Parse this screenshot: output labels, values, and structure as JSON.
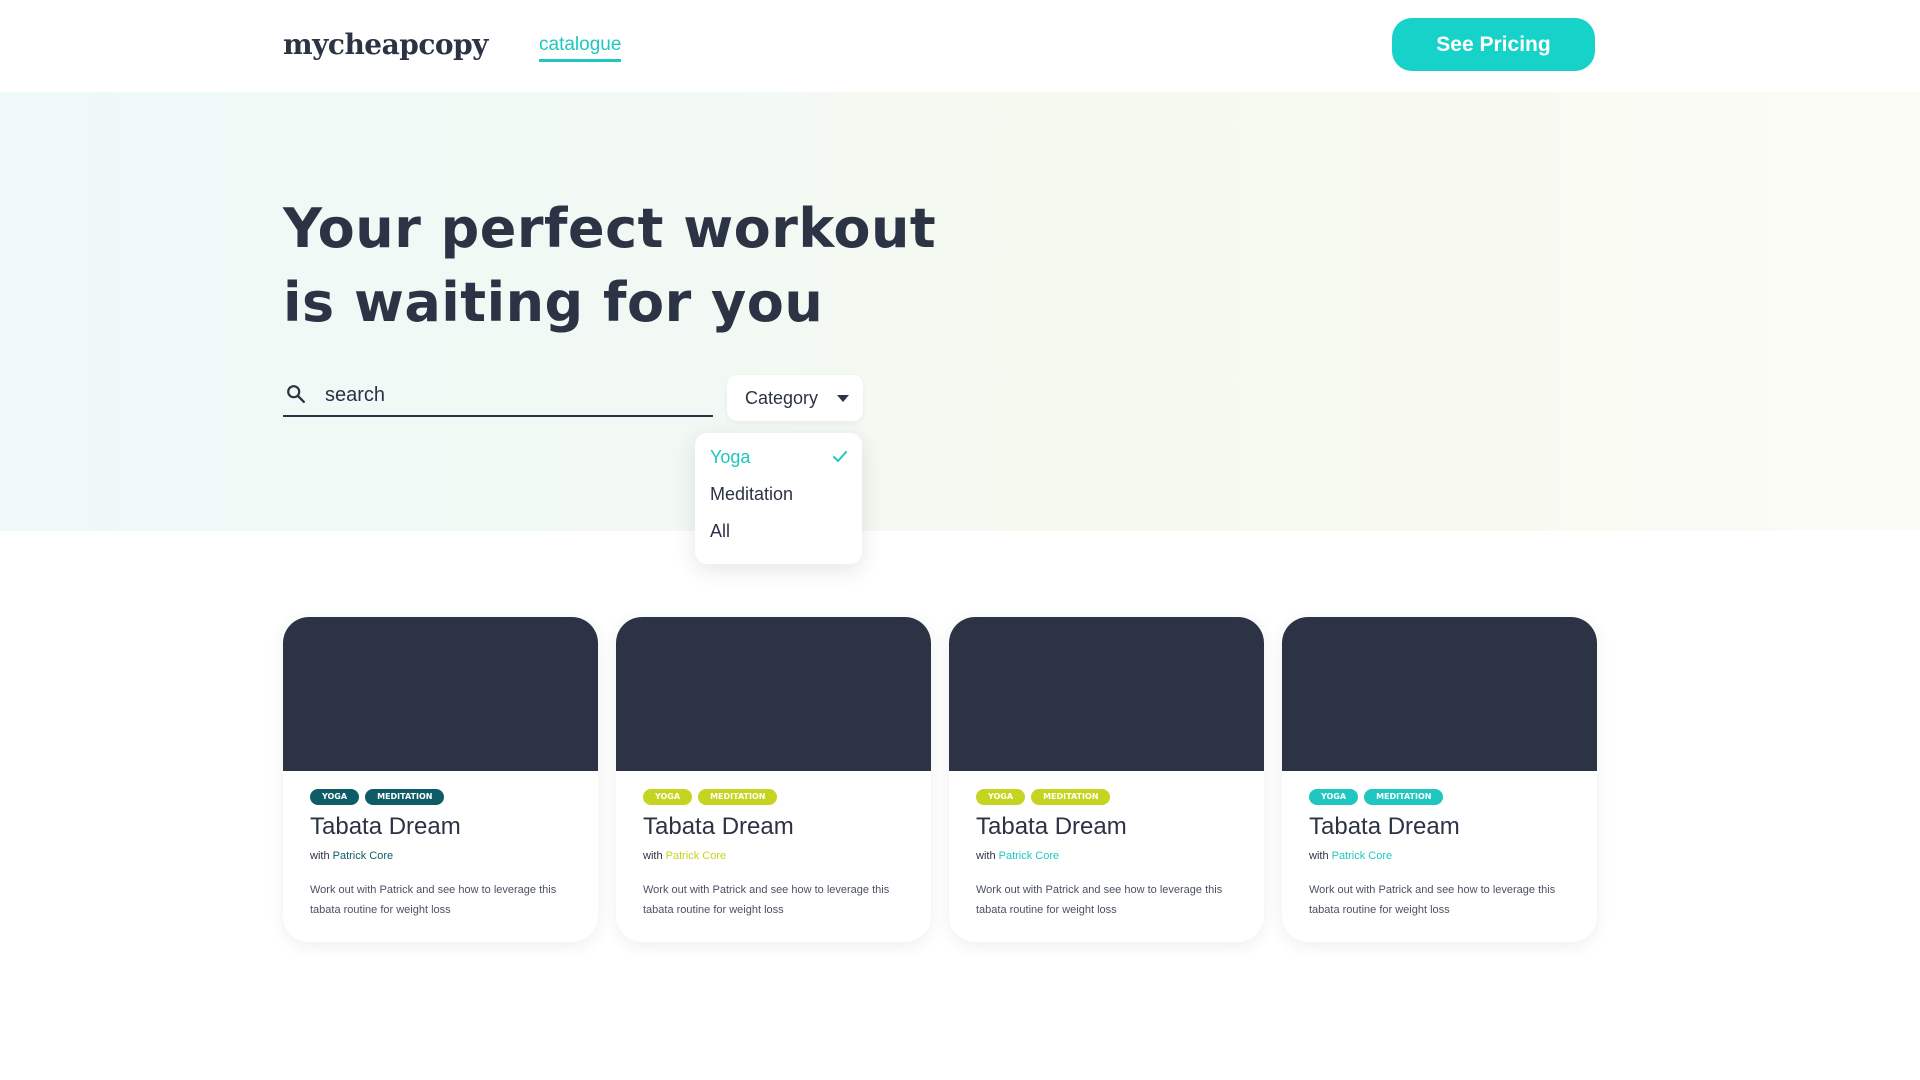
{
  "header": {
    "logo": "mycheapcopy",
    "nav_link": "catalogue",
    "pricing_button": "See Pricing"
  },
  "hero": {
    "title_line1": "Your perfect workout",
    "title_line2": "is waiting for you",
    "search_placeholder": "search",
    "category_label": "Category"
  },
  "dropdown": {
    "options": [
      "Yoga",
      "Meditation",
      "All"
    ],
    "selected": "Yoga"
  },
  "cards": [
    {
      "tags": [
        "YOGA",
        "MEDITATION"
      ],
      "title": "Tabata Dream",
      "with_prefix": "with",
      "instructor": "Patrick Core",
      "description": "Work out with Patrick and see how to leverage this tabata routine for weight loss",
      "accent": "#0e5d66"
    },
    {
      "tags": [
        "YOGA",
        "MEDITATION"
      ],
      "title": "Tabata Dream",
      "with_prefix": "with",
      "instructor": "Patrick Core",
      "description": "Work out with Patrick and see how to leverage this tabata routine for weight loss",
      "accent": "#c5d41e"
    },
    {
      "tags": [
        "YOGA",
        "MEDITATION"
      ],
      "title": "Tabata Dream",
      "with_prefix": "with",
      "instructor": "Patrick Core",
      "description": "Work out with Patrick and see how to leverage this tabata routine for weight loss",
      "accent": "#c5d41e"
    },
    {
      "tags": [
        "YOGA",
        "MEDITATION"
      ],
      "title": "Tabata Dream",
      "with_prefix": "with",
      "instructor": "Patrick Core",
      "description": "Work out with Patrick and see how to leverage this tabata routine for weight loss",
      "accent": "#1fc7c0"
    }
  ],
  "colors": {
    "brand_teal": "#1fc7c0",
    "button_teal": "#17d2c8",
    "dark": "#2c3344"
  },
  "icons": {
    "search": "search-icon",
    "caret": "chevron-down-icon",
    "check": "check-icon"
  }
}
